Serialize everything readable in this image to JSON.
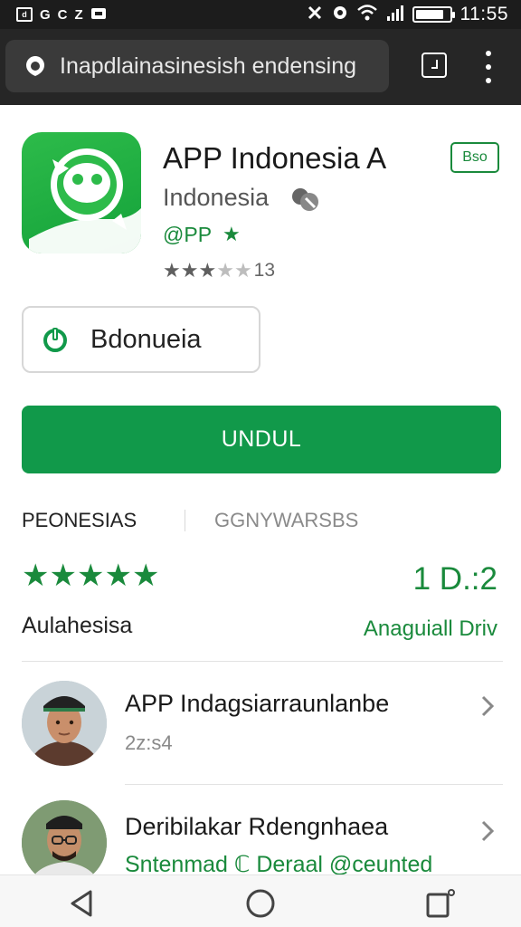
{
  "status_bar": {
    "left_icons": [
      "d",
      "G",
      "C",
      "Z"
    ],
    "time": "11:55",
    "battery_level": 0.85,
    "icons": [
      "notification-icon",
      "chat-icon",
      "refresh-icon",
      "mute-icon",
      "signal-icon",
      "wifi-icon",
      "battery-icon"
    ]
  },
  "browser": {
    "url": "Inapdlainasinesish endensing",
    "icons": [
      "site-icon",
      "tabs-icon",
      "more-menu-icon"
    ]
  },
  "app": {
    "title": "APP Indonesia A",
    "developer": "Indonesia",
    "tag": "@PP",
    "rating_count": "13",
    "rating_stars": 3,
    "badge": "Bso",
    "secondary_button": "Bdonueia",
    "install_button": "UNDUL"
  },
  "tabs": [
    "PEONESIAS",
    "GGNYWARSBS"
  ],
  "ratings": {
    "stars": 5,
    "value": "1 D.:2",
    "label": "Aulahesisa",
    "link": "Anaguiall Driv"
  },
  "list": [
    {
      "title": "APP Indagsiarraunlanbe",
      "subtitle": "2z:s4"
    },
    {
      "title": "Deribilakar Rdengnhaea",
      "subtitle": "Sntenmad ℂ Deraal @ceunted"
    }
  ],
  "colors": {
    "accent": "#11994a",
    "statusbar": "#1c1c1c",
    "browser": "#262626"
  }
}
